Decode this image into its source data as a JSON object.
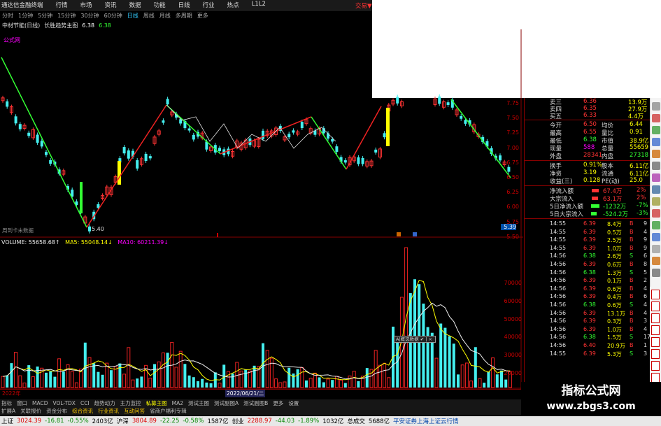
{
  "menubar": {
    "app_title": "通达信金融终端",
    "items": [
      "行情",
      "市场",
      "资讯",
      "数据",
      "功能",
      "日线",
      "行业",
      "热点",
      "L1L2"
    ],
    "trade": "交易▼"
  },
  "periods": [
    "分时",
    "1分钟",
    "5分钟",
    "15分钟",
    "30分钟",
    "60分钟",
    "日线",
    "周线",
    "月线",
    "多周期",
    "更多"
  ],
  "active_period": "日线",
  "title": {
    "stock": "中材节能(日线)",
    "indicator": "长胜趋势主图",
    "v1": "6.38",
    "v2": "6.38"
  },
  "formula_label": "公式网",
  "price_axis": [
    "7.75",
    "7.50",
    "7.25",
    "7.00",
    "6.75",
    "6.50",
    "6.25",
    "6.00",
    "5.75",
    "5.50",
    "5.39"
  ],
  "low_label": "5.40",
  "bottom_label": "周到卡末数据",
  "volume_header": {
    "label": "VOLUME: 55658.68↑",
    "ma5": "MA5: 55048.14↓",
    "ma10": "MA10: 60211.39↓"
  },
  "volume_axis": [
    "70000",
    "60000",
    "50000",
    "40000",
    "30000",
    "20000",
    "10000"
  ],
  "popup": "A|概选数据 ✔ | ×",
  "quote": [
    {
      "k": "卖三",
      "v": "6.36",
      "a": "13.9万"
    },
    {
      "k": "卖四",
      "v": "6.35",
      "a": "27.9万"
    },
    {
      "k": "买五",
      "v": "6.33",
      "a": "4.4万"
    }
  ],
  "stats": [
    {
      "k1": "今开",
      "v1": "6.50",
      "k2": "均价",
      "v2": "6.44"
    },
    {
      "k1": "最高",
      "v1": "6.55",
      "k2": "量比",
      "v2": "0.91"
    },
    {
      "k1": "最低",
      "v1": "6.38",
      "k2": "市值",
      "v2": "38.9亿"
    },
    {
      "k1": "现量",
      "v1": "588",
      "k2": "总量",
      "v2": "55659"
    },
    {
      "k1": "外盘",
      "v1": "28341",
      "k2": "内盘",
      "v2": "27318"
    }
  ],
  "stats2": [
    {
      "k1": "换手",
      "v1": "0.91%",
      "k2": "股本",
      "v2": "6.11亿"
    },
    {
      "k1": "净资",
      "v1": "3.19",
      "k2": "流通",
      "v2": "6.11亿"
    },
    {
      "k1": "收益(三)",
      "v1": "0.128",
      "k2": "PE(动)",
      "v2": "25.0"
    }
  ],
  "flows": [
    {
      "k": "净流入额",
      "v": "67.4万",
      "p": "2%"
    },
    {
      "k": "大宗流入",
      "v": "63.1万",
      "p": "2%"
    },
    {
      "k": "5日净流入额",
      "v": "-1232万",
      "p": "-7%"
    },
    {
      "k": "5日大宗流入",
      "v": "-524.2万",
      "p": "-3%"
    }
  ],
  "ticks": [
    {
      "t": "14:55",
      "p": "6.39",
      "v": "8.4万",
      "s": "B",
      "n": "9"
    },
    {
      "t": "14:55",
      "p": "6.39",
      "v": "0.5万",
      "s": "B",
      "n": "4"
    },
    {
      "t": "14:55",
      "p": "6.39",
      "v": "2.5万",
      "s": "B",
      "n": "9"
    },
    {
      "t": "14:55",
      "p": "6.39",
      "v": "1.0万",
      "s": "B",
      "n": "9"
    },
    {
      "t": "14:56",
      "p": "6.38",
      "v": "2.6万",
      "s": "S",
      "n": "6"
    },
    {
      "t": "14:56",
      "p": "6.39",
      "v": "0.6万",
      "s": "B",
      "n": "8"
    },
    {
      "t": "14:56",
      "p": "6.38",
      "v": "1.3万",
      "s": "S",
      "n": "5"
    },
    {
      "t": "14:56",
      "p": "6.39",
      "v": "0.1万",
      "s": "B",
      "n": "2"
    },
    {
      "t": "14:56",
      "p": "6.39",
      "v": "0.6万",
      "s": "B",
      "n": "4"
    },
    {
      "t": "14:56",
      "p": "6.39",
      "v": "0.4万",
      "s": "B",
      "n": "6"
    },
    {
      "t": "14:56",
      "p": "6.38",
      "v": "0.6万",
      "s": "S",
      "n": "4"
    },
    {
      "t": "14:56",
      "p": "6.39",
      "v": "13.1万",
      "s": "B",
      "n": "4"
    },
    {
      "t": "14:56",
      "p": "6.39",
      "v": "0.3万",
      "s": "B",
      "n": "3"
    },
    {
      "t": "14:56",
      "p": "6.39",
      "v": "1.0万",
      "s": "B",
      "n": "4"
    },
    {
      "t": "14:56",
      "p": "6.38",
      "v": "1.5万",
      "s": "S",
      "n": "17"
    },
    {
      "t": "14:56",
      "p": "6.40",
      "v": "20.9万",
      "s": "B",
      "n": "1"
    },
    {
      "t": "14:55",
      "p": "6.39",
      "v": "5.3万",
      "s": "S",
      "n": "3"
    }
  ],
  "date_axis": {
    "left": "2022年",
    "mid": "2022/06/21/二"
  },
  "tabs1": [
    "指标",
    "窗口",
    "MACD",
    "VOL-TDX",
    "CCI",
    "趋势动力",
    "主力监控",
    "私募主图",
    "MA2",
    "测试主图",
    "测试副图A",
    "测试副图B",
    "更多",
    "设置"
  ],
  "tabs1_active": "私募主图",
  "tabs2": [
    "扩展A",
    "关联报价",
    "资金分布",
    "综合资讯",
    "行业资讯",
    "互动问答",
    "省商户福利专辑"
  ],
  "status": [
    {
      "label": "上证",
      "value": "3024.39",
      "chg": "-16.81",
      "pct": "-0.55%",
      "amt": "2403亿"
    },
    {
      "label": "沪深",
      "value": "3804.89",
      "chg": "-22.25",
      "pct": "-0.58%",
      "amt": "1587亿"
    },
    {
      "label": "创业",
      "value": "2288.97",
      "chg": "-44.03",
      "pct": "-1.89%",
      "amt": "1032亿"
    }
  ],
  "status_total_label": "总成交",
  "status_total": "5688亿",
  "status_broker": "平安证券上海上证云行情",
  "watermark": {
    "cn": "指标公式网",
    "url": "www.zbgs3.com"
  },
  "chart_data": [
    {
      "type": "candlestick",
      "title": "中材节能(日线)",
      "y_axis_ticks": [
        7.75,
        7.5,
        7.25,
        7.0,
        6.75,
        6.5,
        6.25,
        6.0,
        5.75,
        5.5
      ],
      "low_marker": 5.4,
      "current": 6.38
    },
    {
      "type": "bar",
      "title": "VOLUME",
      "y_axis_ticks": [
        70000,
        60000,
        50000,
        40000,
        30000,
        20000,
        10000
      ],
      "volume": 55658.68,
      "ma5": 55048.14,
      "ma10": 60211.39
    }
  ]
}
